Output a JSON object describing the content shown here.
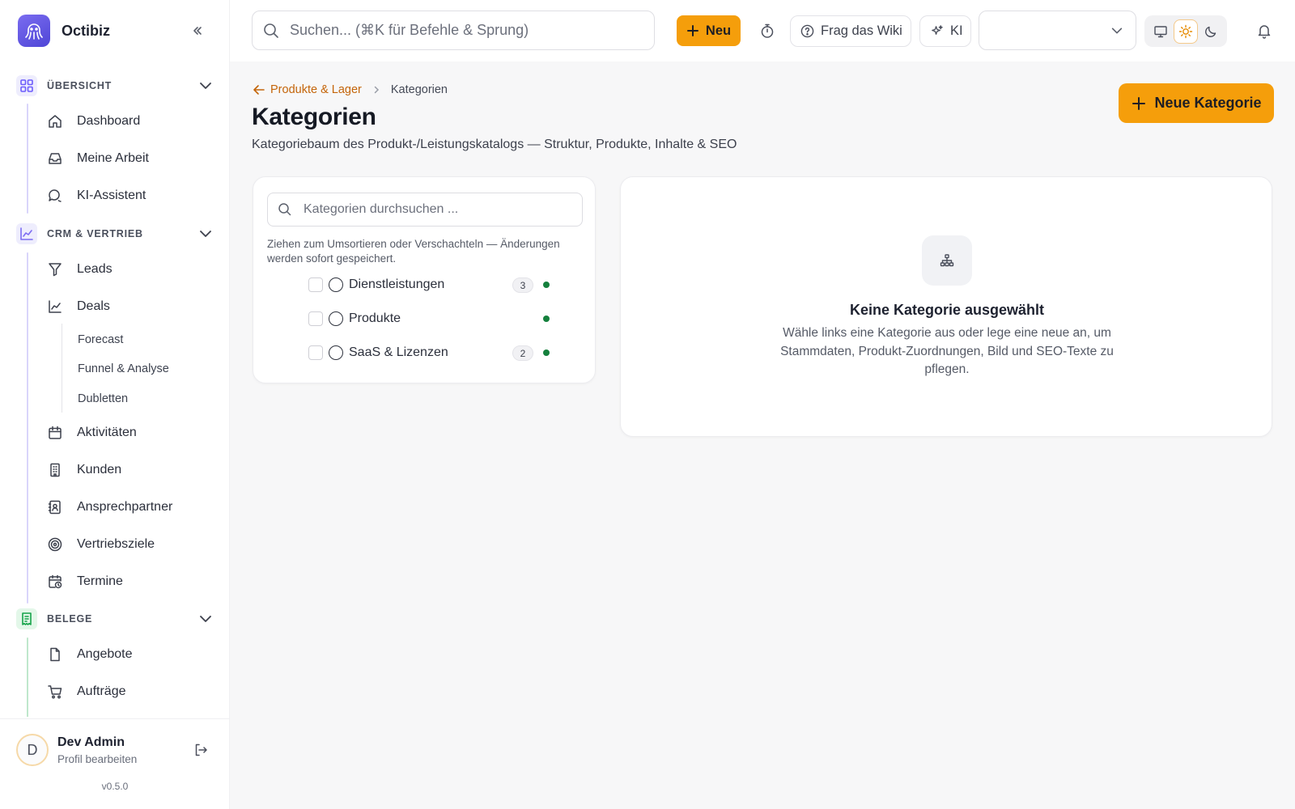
{
  "app": {
    "name": "Octibiz"
  },
  "sidebar": {
    "sections": [
      {
        "label": "ÜBERSICHT",
        "color": "#6d5dfc"
      },
      {
        "label": "CRM & VERTRIEB",
        "color": "#7c6cf2"
      },
      {
        "label": "BELEGE",
        "color": "#16a34a"
      }
    ],
    "overview_items": [
      {
        "label": "Dashboard",
        "icon": "home-icon"
      },
      {
        "label": "Meine Arbeit",
        "icon": "inbox-icon"
      },
      {
        "label": "KI-Assistent",
        "icon": "chat-icon"
      }
    ],
    "crm_items": [
      {
        "label": "Leads",
        "icon": "funnel-icon"
      },
      {
        "label": "Deals",
        "icon": "trend-chart-icon"
      },
      {
        "label": "Aktivitäten",
        "icon": "calendar-icon"
      },
      {
        "label": "Kunden",
        "icon": "building-icon"
      },
      {
        "label": "Ansprechpartner",
        "icon": "contact-book-icon"
      },
      {
        "label": "Vertriebsziele",
        "icon": "target-icon"
      },
      {
        "label": "Termine",
        "icon": "calendar-clock-icon"
      }
    ],
    "deal_subitems": [
      "Forecast",
      "Funnel & Analyse",
      "Dubletten"
    ],
    "beleg_items": [
      {
        "label": "Angebote",
        "icon": "file-icon"
      },
      {
        "label": "Aufträge",
        "icon": "cart-icon"
      }
    ],
    "user": {
      "initial": "D",
      "name": "Dev Admin",
      "profile_link": "Profil bearbeiten"
    },
    "version": "v0.5.0"
  },
  "topbar": {
    "search_placeholder": "Suchen... (⌘K für Befehle & Sprung)",
    "new_label": "Neu",
    "wiki_label": "Frag das Wiki",
    "ki_label": "KI",
    "select_value": "",
    "theme_options": [
      "monitor-icon",
      "sun-icon",
      "moon-icon"
    ],
    "theme_active": "sun-icon"
  },
  "page": {
    "breadcrumb_parent": "Produkte & Lager",
    "breadcrumb_current": "Kategorien",
    "title": "Kategorien",
    "subtitle": "Kategoriebaum des Produkt-/Leistungskatalogs — Struktur, Produkte, Inhalte & SEO",
    "new_category_label": "Neue Kategorie"
  },
  "tree": {
    "search_placeholder": "Kategorien durchsuchen ...",
    "hint": "Ziehen zum Umsortieren oder Verschachteln — Änderungen werden sofort gespeichert.",
    "items": [
      {
        "name": "Dienstleistungen",
        "count": "3",
        "active": true
      },
      {
        "name": "Produkte",
        "count": "",
        "active": true
      },
      {
        "name": "SaaS & Lizenzen",
        "count": "2",
        "active": true
      }
    ]
  },
  "detail": {
    "empty_title": "Keine Kategorie ausgewählt",
    "empty_text": "Wähle links eine Kategorie aus oder lege eine neue an, um Stammdaten, Produkt-Zuordnungen, Bild und SEO-Texte zu pflegen."
  },
  "colors": {
    "accent": "#f59e0b",
    "link": "#c4650a",
    "status_active": "#15803d"
  }
}
